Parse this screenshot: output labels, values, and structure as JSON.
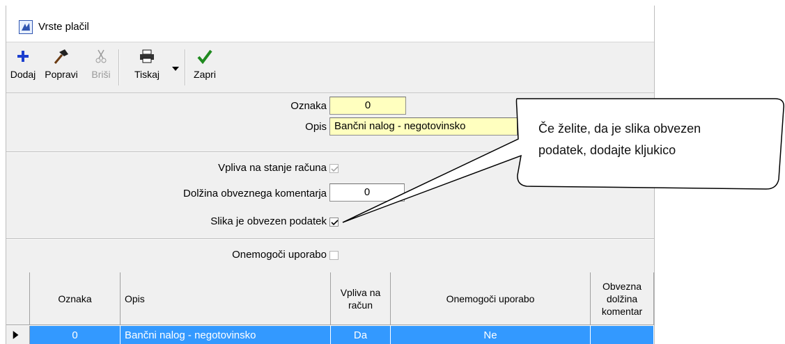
{
  "window": {
    "title": "Vrste plačil"
  },
  "toolbar": {
    "add": "Dodaj",
    "edit": "Popravi",
    "delete": "Briši",
    "print": "Tiskaj",
    "close": "Zapri"
  },
  "form": {
    "oznaka_label": "Oznaka",
    "oznaka_value": "0",
    "opis_label": "Opis",
    "opis_value": "Bančni nalog - negotovinsko",
    "vpliva_label": "Vpliva na stanje računa",
    "dolzina_label": "Dolžina obveznega komentarja",
    "dolzina_value": "0",
    "slika_label": "Slika je obvezen podatek",
    "onemogoci_label": "Onemogoči uporabo"
  },
  "grid": {
    "columns": [
      "Oznaka",
      "Opis",
      "Vpliva na račun",
      "Onemogoči uporabo",
      "Obvezna dolžina komentar"
    ],
    "rows": [
      [
        "0",
        "Bančni nalog - negotovinsko",
        "Da",
        "Ne",
        ""
      ]
    ]
  },
  "callout": {
    "line1": "Če želite, da je slika obvezen",
    "line2": "podatek, dodajte kljukico"
  }
}
